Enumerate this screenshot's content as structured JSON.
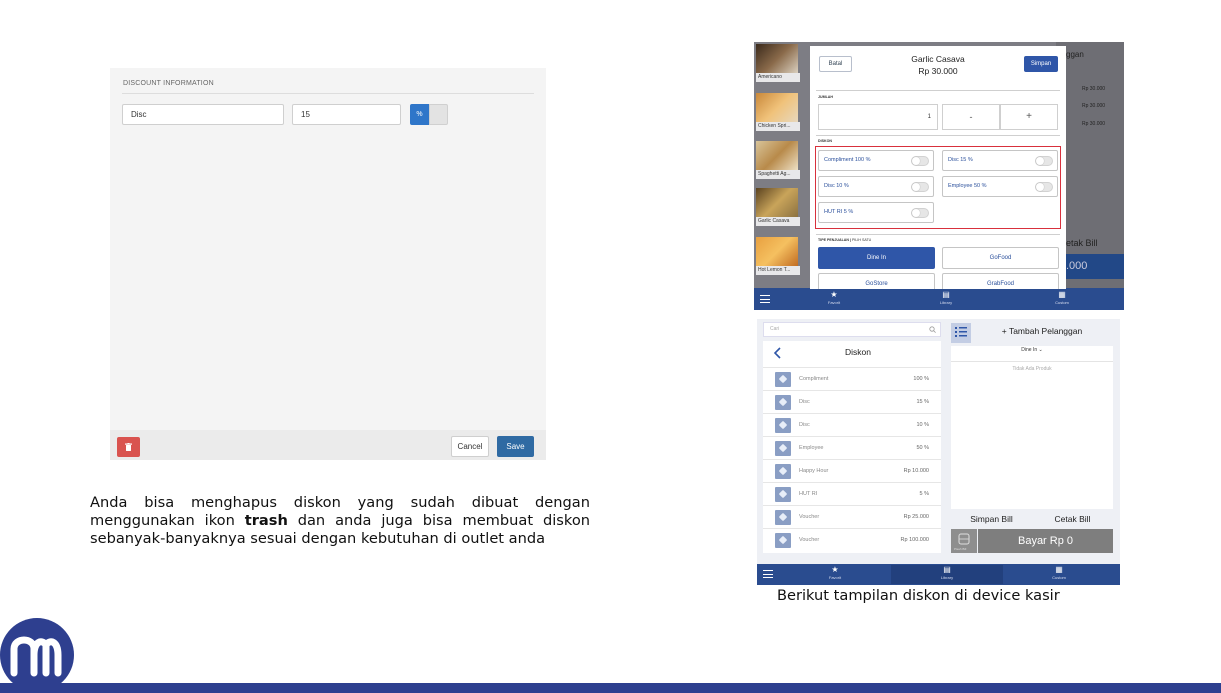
{
  "discount_form": {
    "heading": "DISCOUNT INFORMATION",
    "name_value": "Disc",
    "amount_value": "15",
    "percent_label": "%",
    "cancel_label": "Cancel",
    "save_label": "Save"
  },
  "description": {
    "part1": "Anda bisa menghapus diskon yang sudah dibuat dengan menggunakan ikon ",
    "bold": "trash",
    "part2": " dan anda juga bisa membuat diskon sebanyak-banyaknya sesuai dengan kebutuhan di outlet anda"
  },
  "pos_dialog": {
    "products": [
      "Americano",
      "Chicken Spri...",
      "Spaghetti Ag...",
      "Garlic Casava",
      "Hot Lemon T..."
    ],
    "bg_customer_fragment": "ggan",
    "bg_prices": [
      "Rp 30.000",
      "Rp 30.000",
      "Rp 30.000"
    ],
    "bg_cetak_fragment": "etak Bill",
    "bg_total_fragment": ".000",
    "batal_label": "Batal",
    "title": "Garlic Casava",
    "price": "Rp 30.000",
    "simpan_label": "Simpan",
    "jumlah_label": "JUMLAH",
    "qty": "1",
    "minus": "-",
    "plus": "+",
    "diskon_label": "DISKON",
    "discounts": [
      "Compliment 100 %",
      "Disc 15 %",
      "Disc 10 %",
      "Employee 50 %",
      "HUT RI 5 %"
    ],
    "tipe_label": "TIPE PENJUALAN",
    "tipe_hint": "PILIH SATU",
    "tipe_options": [
      "Dine In",
      "GoFood",
      "GoStore",
      "GrabFood"
    ],
    "active_tipe": "Dine In"
  },
  "pos_list": {
    "search_placeholder": "Cari",
    "title": "Diskon",
    "rows": [
      {
        "name": "Compliment",
        "value": "100 %"
      },
      {
        "name": "Disc",
        "value": "15 %"
      },
      {
        "name": "Disc",
        "value": "10 %"
      },
      {
        "name": "Employee",
        "value": "50 %"
      },
      {
        "name": "Happy Hour",
        "value": "Rp 10.000"
      },
      {
        "name": "HUT RI",
        "value": "5 %"
      },
      {
        "name": "Voucher",
        "value": "Rp 25.000"
      },
      {
        "name": "Voucher",
        "value": "Rp 100.000"
      }
    ],
    "customer_label": "+ Tambah Pelanggan",
    "order_type": "Dine In",
    "empty_text": "Tidak Ada Produk",
    "simpan_bill": "Simpan Bill",
    "cetak_bill": "Cetak Bill",
    "pay_icon_label": "Pisah Bill",
    "bayar_label": "Bayar Rp 0"
  },
  "nav": {
    "items": [
      "Favorit",
      "Library",
      "Custom"
    ],
    "active": "Library"
  },
  "caption": "Berikut tampilan diskon di device kasir",
  "colors": {
    "brand_blue": "#2e3f8f",
    "pos_blue": "#2f56a8",
    "trash_red": "#d9534f",
    "save_blue": "#2f6aa3",
    "highlight_red": "#d8303c"
  }
}
